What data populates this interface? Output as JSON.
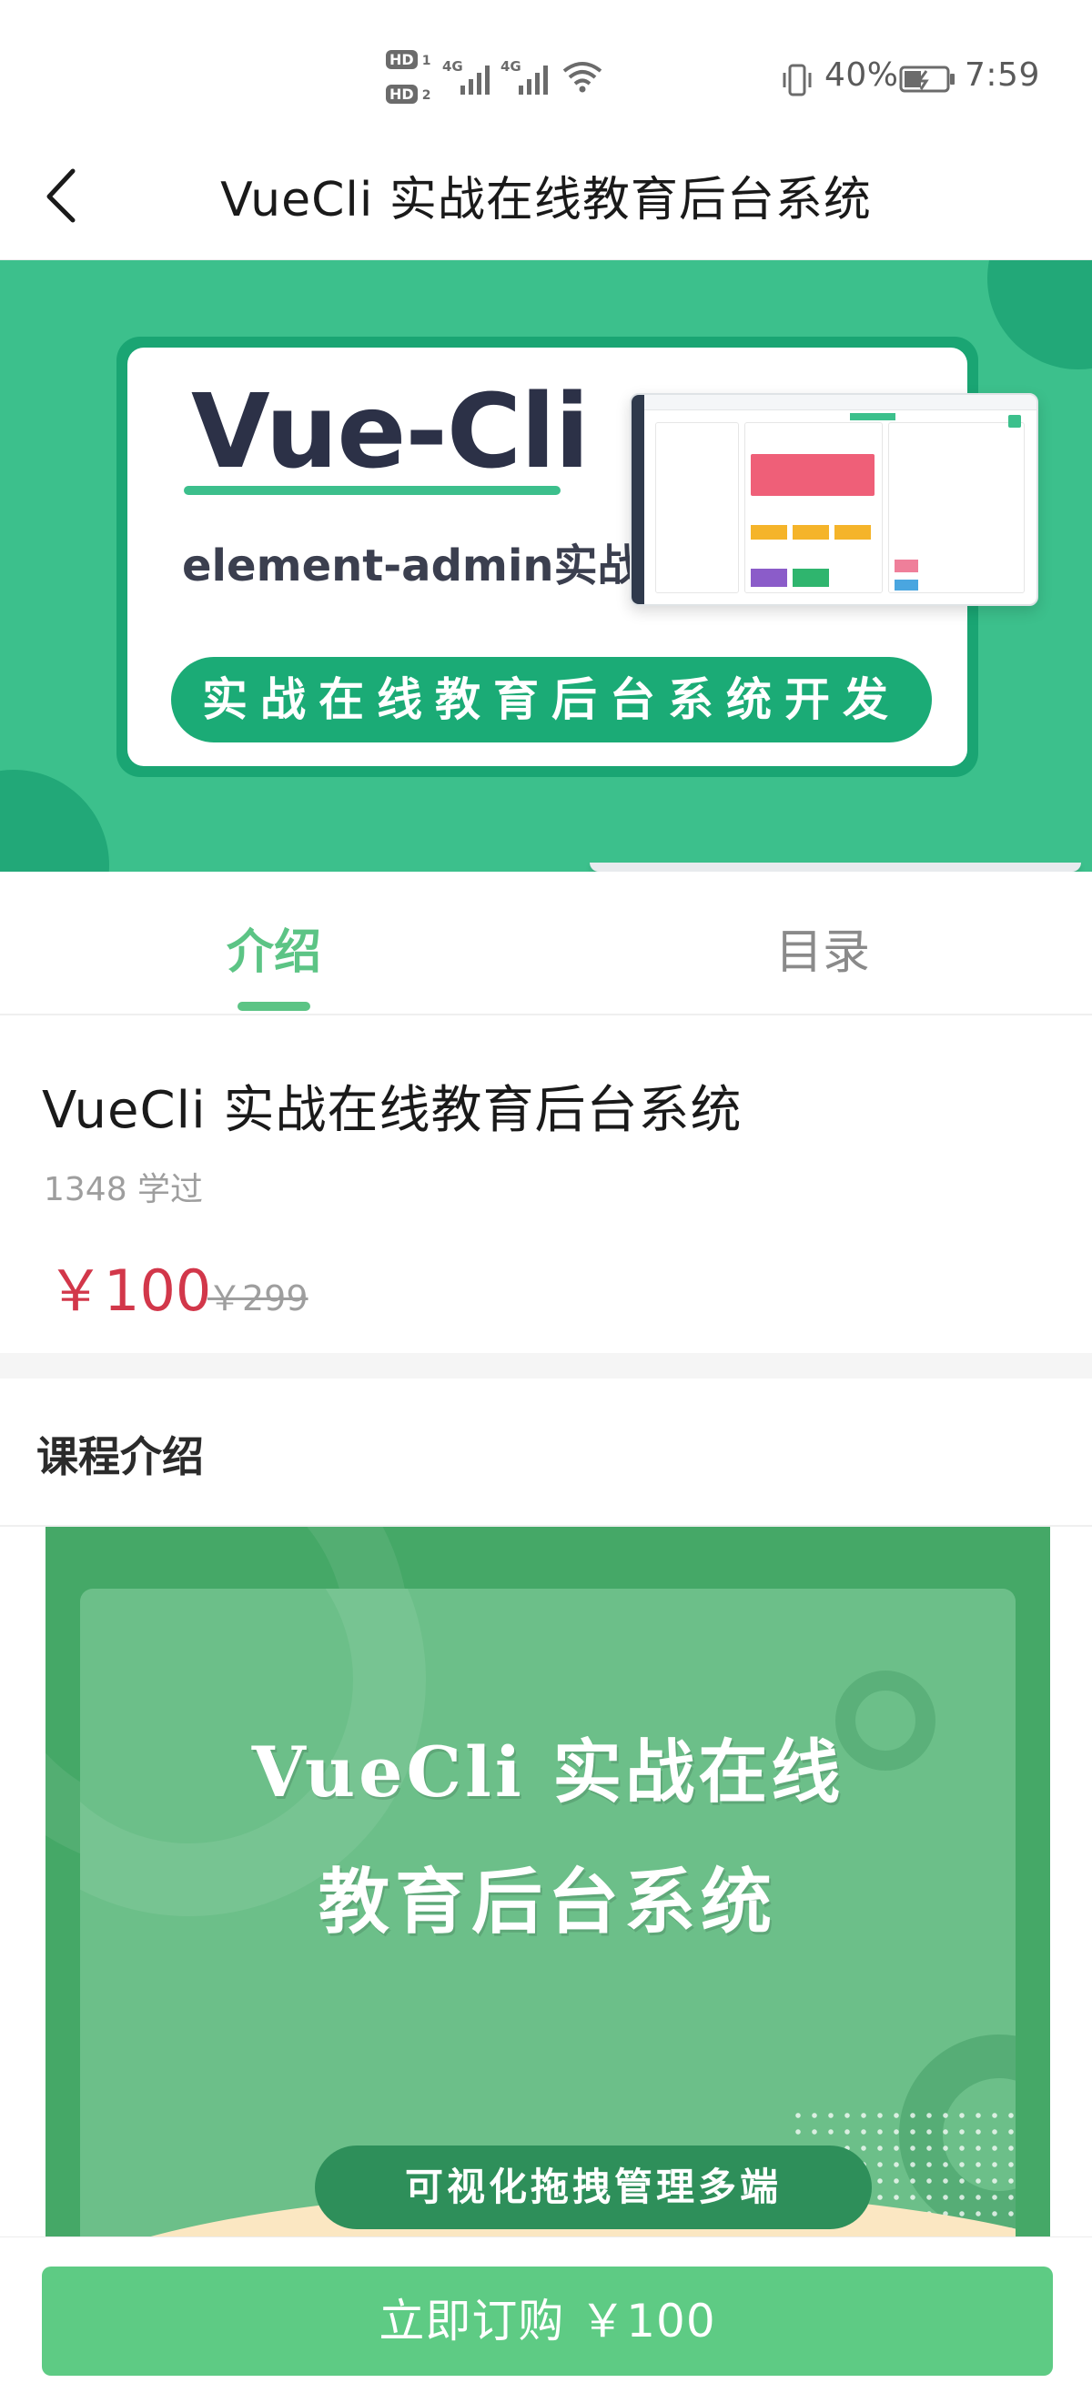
{
  "status_bar": {
    "hd1": "HD",
    "hd1_sub": "1",
    "hd2": "HD",
    "hd2_sub": "2",
    "net1": "4G",
    "net2": "4G",
    "battery": "40%",
    "time": "7:59"
  },
  "header": {
    "title": "VueCli 实战在线教育后台系统"
  },
  "banner": {
    "title": "Vue-Cli",
    "subtitle": "element-admin实战",
    "pill": "实战在线教育后台系统开发"
  },
  "tabs": [
    {
      "label": "介绍",
      "active": true
    },
    {
      "label": "目录",
      "active": false
    }
  ],
  "course": {
    "title": "VueCli 实战在线教育后台系统",
    "learners": "1348 学过",
    "price": "￥100",
    "original_price": "￥299"
  },
  "intro": {
    "heading": "课程介绍",
    "poster_line1": "VueCli 实战在线",
    "poster_line2": "教育后台系统",
    "poster_pill": "可视化拖拽管理多端"
  },
  "bottom": {
    "buy_label": "立即订购 ￥100"
  },
  "colors": {
    "brand_green": "#5cc485",
    "price_red": "#d2374a",
    "banner_green": "#3cc08c"
  }
}
